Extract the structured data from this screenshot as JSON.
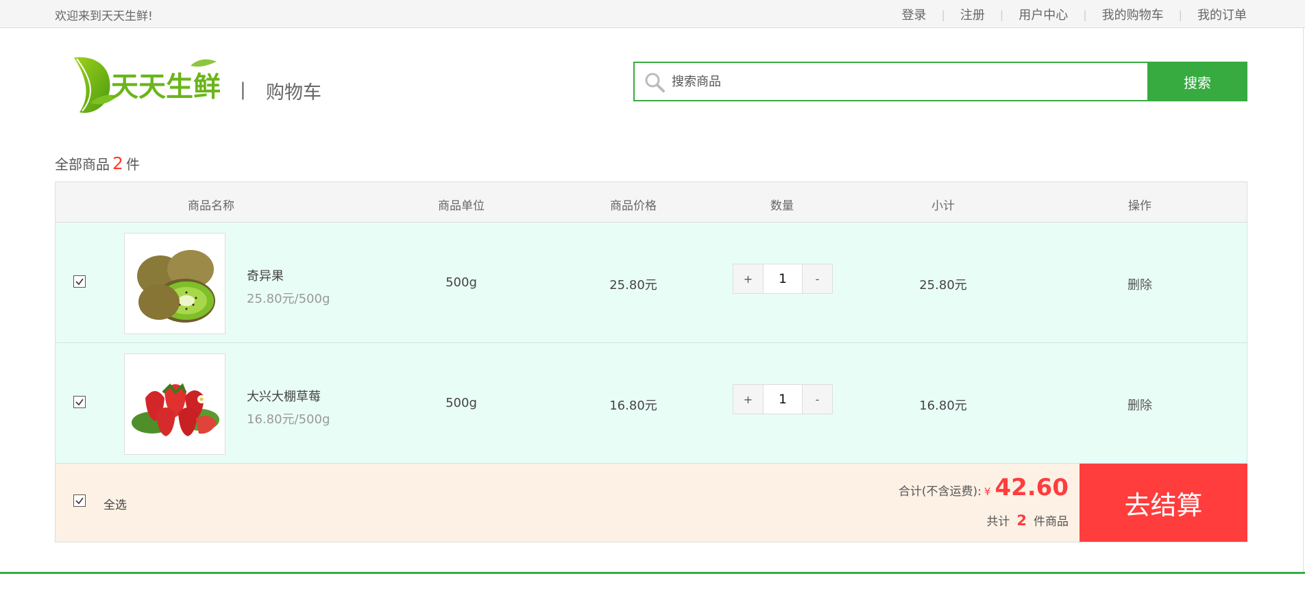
{
  "topbar": {
    "welcome": "欢迎来到天天生鲜!",
    "links": [
      "登录",
      "注册",
      "用户中心",
      "我的购物车",
      "我的订单"
    ],
    "separator": "|"
  },
  "header": {
    "logo_text": "天天生鲜",
    "divider": "|",
    "page_title": "购物车"
  },
  "search": {
    "placeholder": "搜索商品",
    "button": "搜索"
  },
  "summary": {
    "prefix": "全部商品",
    "count": "2",
    "suffix": "件"
  },
  "table": {
    "columns": [
      "商品名称",
      "商品单位",
      "商品价格",
      "数量",
      "小计",
      "操作"
    ],
    "rows": [
      {
        "checked": true,
        "image": "kiwi-image",
        "name": "奇异果",
        "unit_price": "25.80元/500g",
        "unit": "500g",
        "price": "25.80元",
        "plus": "+",
        "qty": "1",
        "minus": "-",
        "subtotal": "25.80元",
        "action": "删除"
      },
      {
        "checked": true,
        "image": "strawberry-image",
        "name": "大兴大棚草莓",
        "unit_price": "16.80元/500g",
        "unit": "500g",
        "price": "16.80元",
        "plus": "+",
        "qty": "1",
        "minus": "-",
        "subtotal": "16.80元",
        "action": "删除"
      }
    ]
  },
  "footer": {
    "select_all": "全选",
    "total_label": "合计(不含运费):",
    "currency": "¥",
    "total": "42.60",
    "count_prefix": "共计",
    "count": "2",
    "count_suffix": "件商品",
    "checkout": "去结算"
  },
  "colors": {
    "brand_green": "#37ab40",
    "accent_red": "#ff3d3d",
    "row_bg": "#e9fdf7",
    "footer_bg": "#fdf1e5"
  }
}
